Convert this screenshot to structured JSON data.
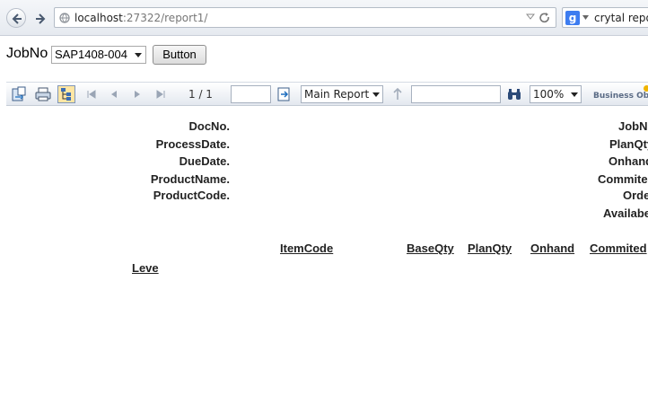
{
  "browser": {
    "url_host": "localhost",
    "url_rest": ":27322/report1/",
    "search_query": "crytal report"
  },
  "form": {
    "jobno_label": "JobNo",
    "jobno_selected": "SAP1408-004",
    "button_label": "Button"
  },
  "toolbar": {
    "page_indicator": "1 / 1",
    "goto_page_value": "",
    "report_select": "Main Report",
    "search_value": "",
    "zoom": "100%",
    "logo_text": "Business Objects"
  },
  "report": {
    "left_labels": [
      "DocNo.",
      "ProcessDate.",
      "DueDate.",
      "ProductName.",
      "ProductCode."
    ],
    "right_labels": [
      "JobNo",
      "PlanQty",
      "Onhand",
      "Commited",
      "Order",
      "Availabe"
    ],
    "columns": [
      "ItemCode",
      "BaseQty",
      "PlanQty",
      "Onhand",
      "Commited"
    ],
    "level_label": "Leve"
  },
  "colors": {
    "accent_google": "#3d7cf0",
    "toolbar_highlight": "#ffe6a4"
  }
}
